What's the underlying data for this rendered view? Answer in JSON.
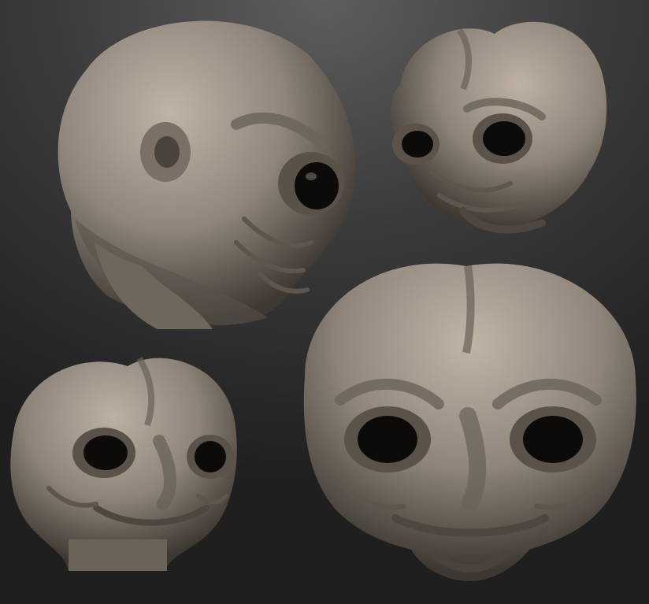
{
  "scene": {
    "background_top": "#5e5e5e",
    "background_bottom": "#1f1f1f",
    "clay_light": "#b8ad9f",
    "clay_mid": "#8c8276",
    "clay_dark": "#3f3933",
    "eye_color": "#0d0b0a"
  },
  "renders": [
    {
      "view": "three-quarter-side"
    },
    {
      "view": "three-quarter-front-small"
    },
    {
      "view": "front-small"
    },
    {
      "view": "front-large"
    }
  ]
}
